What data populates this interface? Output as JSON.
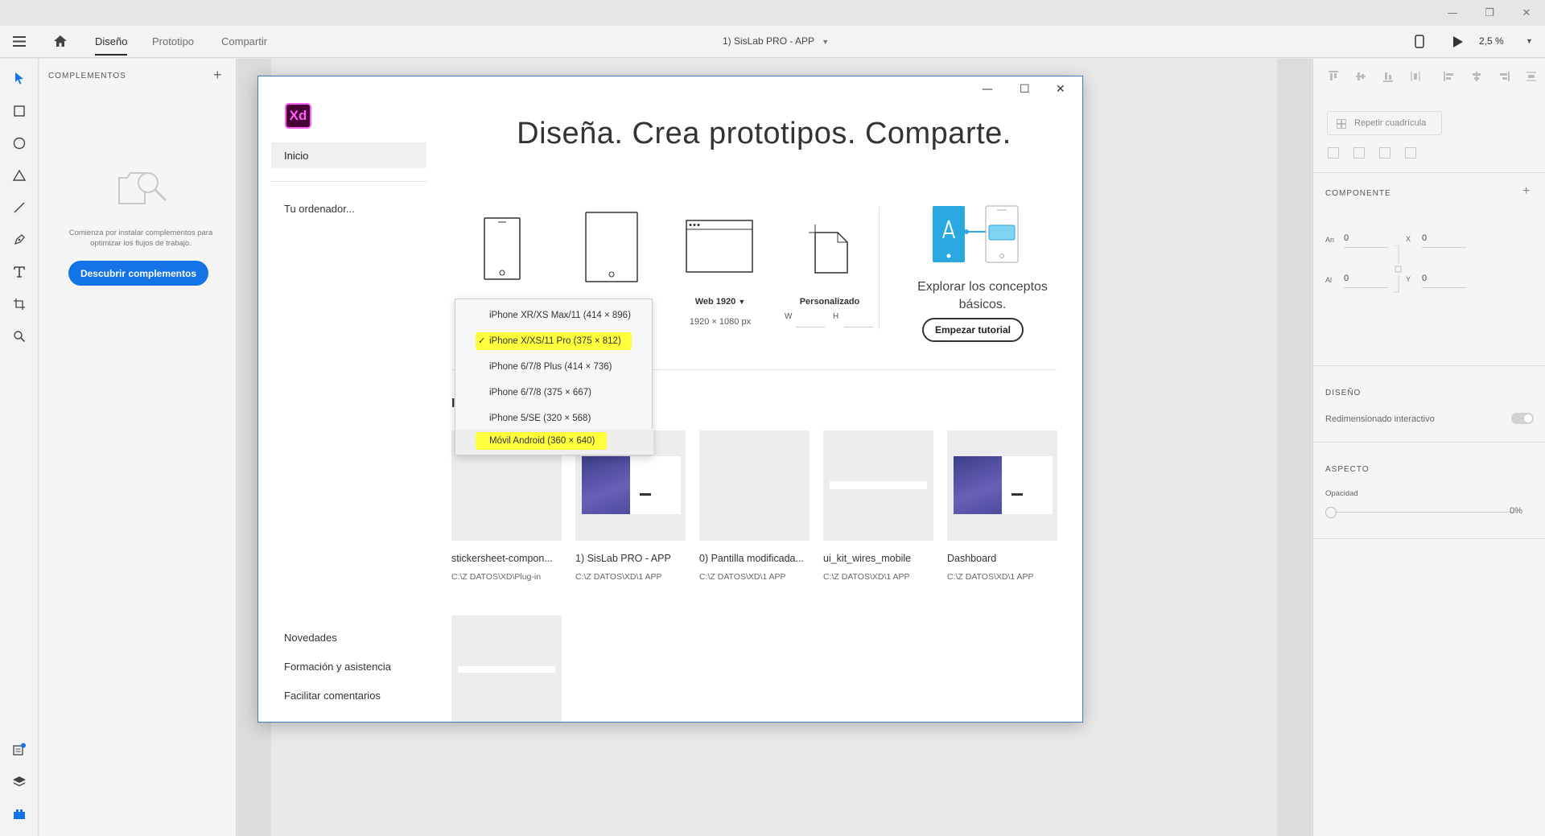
{
  "window": {
    "controls": [
      "—",
      "❐",
      "✕"
    ]
  },
  "menubar": {
    "tabs": [
      {
        "label": "Diseño",
        "active": true
      },
      {
        "label": "Prototipo",
        "active": false
      },
      {
        "label": "Compartir",
        "active": false
      }
    ],
    "doc_title": "1) SisLab PRO - APP",
    "zoom": "2,5 %"
  },
  "plugins": {
    "header": "COMPLEMENTOS",
    "message": "Comienza por instalar complementos para optimizar los flujos de trabajo.",
    "button": "Descubrir complementos"
  },
  "right_panel": {
    "repeat_grid": "Repetir cuadrícula",
    "component": "COMPONENTE",
    "an_label": "An",
    "an_value": "0",
    "x_label": "X",
    "x_value": "0",
    "al_label": "Al",
    "al_value": "0",
    "y_label": "Y",
    "y_value": "0",
    "design": "DISEÑO",
    "responsive": "Redimensionado interactivo",
    "appearance": "ASPECTO",
    "opacity_label": "Opacidad",
    "opacity_value": "0%"
  },
  "dialog": {
    "logo": "Xd",
    "nav_home": "Inicio",
    "nav_computer": "Tu ordenador...",
    "nav_bottom": [
      "Novedades",
      "Formación y asistencia",
      "Facilitar comentarios"
    ],
    "hero": "Diseña. Crea prototipos. Comparte.",
    "web_preset": "Web 1920",
    "web_dims": "1920 × 1080 px",
    "custom_preset": "Personalizado",
    "custom_w": "W",
    "custom_h": "H",
    "explore": "Explorar los conceptos básicos.",
    "tutorial_button": "Empezar tutorial",
    "section_initial": "I",
    "recent_files": [
      {
        "name": "stickersheet-compon...",
        "path": "C:\\Z DATOS\\XD\\Plug-in"
      },
      {
        "name": "1) SisLab PRO - APP",
        "path": "C:\\Z DATOS\\XD\\1 APP"
      },
      {
        "name": "0) Pantilla modificada...",
        "path": "C:\\Z DATOS\\XD\\1 APP"
      },
      {
        "name": "ui_kit_wires_mobile",
        "path": "C:\\Z DATOS\\XD\\1 APP"
      },
      {
        "name": "Dashboard",
        "path": "C:\\Z DATOS\\XD\\1 APP"
      }
    ]
  },
  "dropdown": {
    "items": [
      {
        "label": "iPhone XR/XS Max/11 (414 × 896)",
        "checked": false,
        "highlight": false
      },
      {
        "label": "iPhone X/XS/11 Pro (375 × 812)",
        "checked": true,
        "highlight": true
      },
      {
        "label": "iPhone 6/7/8 Plus (414 × 736)",
        "checked": false,
        "highlight": false
      },
      {
        "label": "iPhone 6/7/8 (375 × 667)",
        "checked": false,
        "highlight": false
      },
      {
        "label": "iPhone 5/SE (320 × 568)",
        "checked": false,
        "highlight": false
      },
      {
        "label": "Móvil Android (360 × 640)",
        "checked": false,
        "highlight": true
      }
    ],
    "check_mark": "✓"
  },
  "colors": {
    "accent": "#1473e6",
    "highlight": "#ffff3c",
    "xd_bg": "#470137",
    "xd_pink": "#ff61f6",
    "tutorial_blue": "#2aa9e0"
  }
}
